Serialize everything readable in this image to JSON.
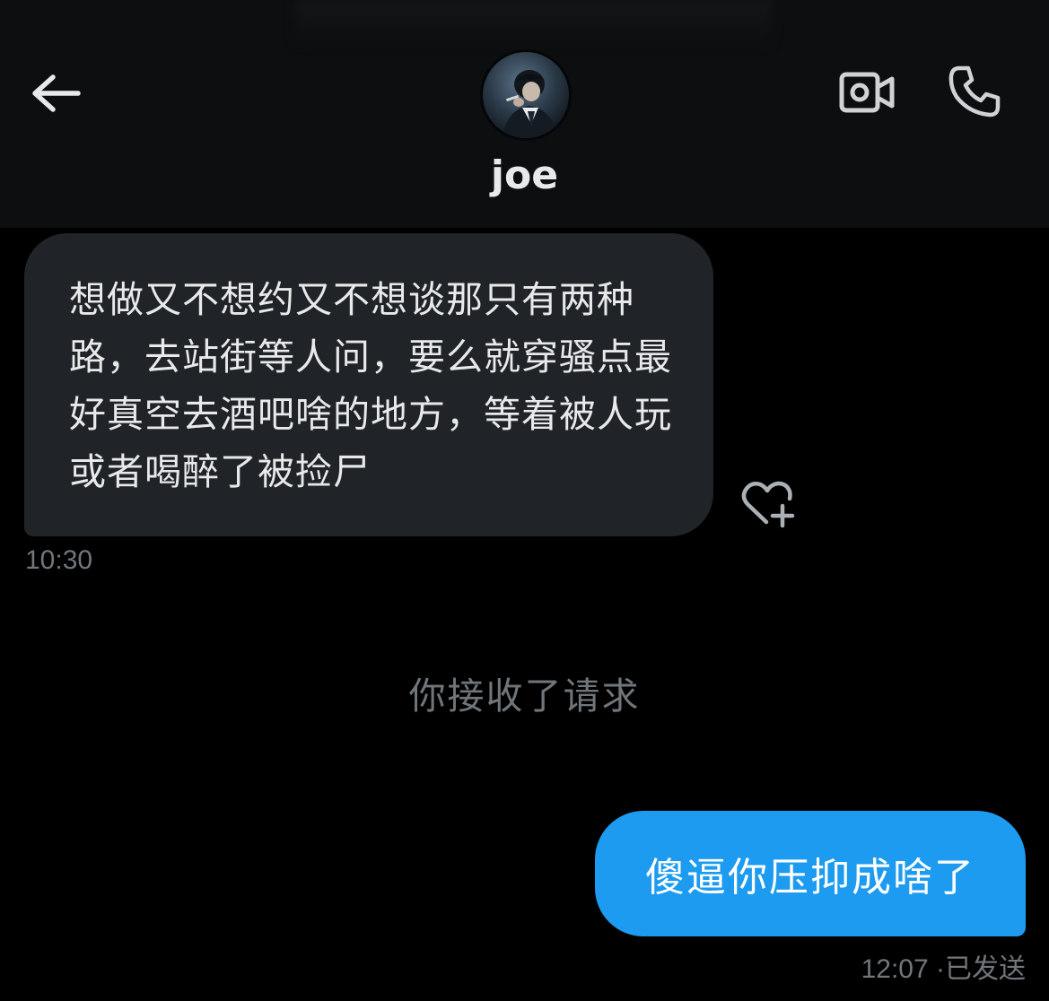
{
  "header": {
    "contact_name": "joe",
    "back_icon": "arrow-left-icon",
    "video_icon": "video-camera-icon",
    "call_icon": "phone-icon",
    "avatar": "profile-avatar"
  },
  "messages": [
    {
      "direction": "incoming",
      "text": "想做又不想约又不想谈那只有两种路，去站街等人问，要么就穿骚点最好真空去酒吧啥的地方，等着被人玩或者喝醉了被捡尸",
      "time": "10:30",
      "reaction_icon": "heart-plus-icon"
    },
    {
      "direction": "system",
      "text": "你接收了请求"
    },
    {
      "direction": "outgoing",
      "text": "傻逼你压抑成啥了",
      "time": "12:07",
      "status": "已发送",
      "separator": "·"
    }
  ],
  "colors": {
    "background": "#000000",
    "header_background": "#0d0e0f",
    "incoming_bubble": "#202327",
    "outgoing_bubble": "#1d9bf0",
    "secondary_text": "#71767b",
    "primary_text": "#e7e9ea",
    "icon_color": "#cfd3d6"
  }
}
